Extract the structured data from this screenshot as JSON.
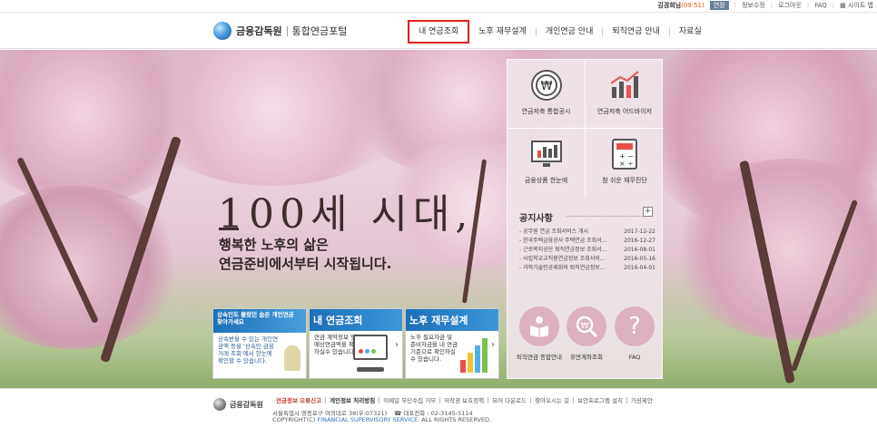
{
  "topbar": {
    "user_name": "김경희님",
    "timer": "(09:51)",
    "extend": "연장",
    "info_edit": "정보수정",
    "logout": "로그아웃",
    "faq": "FAQ",
    "sitemap": "사이트 맵"
  },
  "header": {
    "logo_org": "금융감독원",
    "logo_service": "통합연금포털",
    "nav": [
      {
        "label": "내 연금조회",
        "active": true
      },
      {
        "label": "노후 재무설계"
      },
      {
        "label": "개인연금 안내"
      },
      {
        "label": "퇴직연금 안내"
      },
      {
        "label": "자료실"
      }
    ]
  },
  "hero": {
    "slogan_big": "100세 시대,",
    "slogan_sub_1": "행복한 노후의 삶은",
    "slogan_sub_2": "연금준비에서부터 시작됩니다."
  },
  "cards": [
    {
      "title": "상속인도 몰랐던 숨은 개인연금 찾아가세요",
      "desc": "상속받을 수 있는 개인연금액 등을 '상속인 금융거래 조회'에서 한눈에 확인할 수 있습니다."
    },
    {
      "title": "내 연금조회",
      "desc": "연금 계약정보 및 예상연금액을 확인하실수 있습니다."
    },
    {
      "title": "노후 재무설계",
      "desc": "노후 필요자금 및 준비자금을 내 연금기준으로 확인하실 수 있습니다."
    }
  ],
  "quick_tiles": [
    {
      "label": "연금저축 통합공시",
      "icon": "won-coin-icon"
    },
    {
      "label": "연금저축 어드바이저",
      "icon": "rising-chart-icon"
    },
    {
      "label": "금융상품 한눈에",
      "icon": "monitor-chart-icon"
    },
    {
      "label": "참 쉬운 재무진단",
      "icon": "calculator-icon"
    }
  ],
  "notice": {
    "title": "공지사항",
    "more": "+",
    "items": [
      {
        "title": "공무원 연금 조회서비스 개시",
        "date": "2017-12-22"
      },
      {
        "title": "한국주택금융공사 주택연금 조회서...",
        "date": "2016-12-27"
      },
      {
        "title": "근로복지공단 퇴직연금정보 조회서...",
        "date": "2016-08-01"
      },
      {
        "title": "사립학교교직원연금정보 조회서비...",
        "date": "2016-05-16"
      },
      {
        "title": "과학기술인공제회의 퇴직연금정보...",
        "date": "2016-04-01"
      }
    ]
  },
  "circles": [
    {
      "label": "퇴직연금 종합안내",
      "icon": "book-reader-icon"
    },
    {
      "label": "휴면계좌조회",
      "icon": "won-magnifier-icon"
    },
    {
      "label": "FAQ",
      "icon": "question-icon"
    }
  ],
  "footer": {
    "org": "금융감독원",
    "links": [
      "연금정보 오류신고",
      "개인정보 처리방침",
      "이메일 무단수집 거부",
      "저작권 보호정책",
      "뷰어 다운로드",
      "찾아오시는 길",
      "보안프로그램 설치",
      "가션제안"
    ],
    "address": "서울특별시 영등포구 여의대로 38(우:07321)",
    "phone": "대표전화 : 02-3145-5114",
    "copyright_prefix": "COPYRIGHT(C)",
    "copyright_org": "FINANCIAL SUPERVISORY SERVICE.",
    "copyright_suffix": "ALL RIGHTS RESERVED."
  }
}
